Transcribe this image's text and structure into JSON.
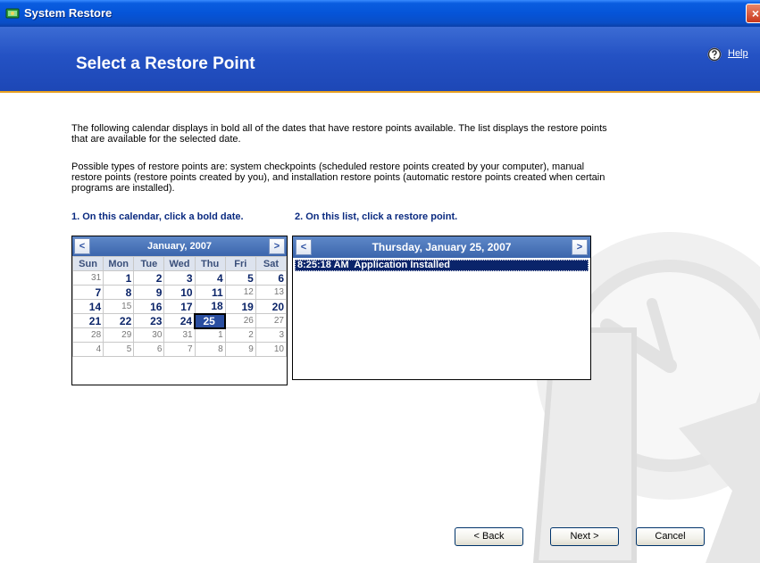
{
  "window": {
    "title": "System Restore",
    "close_label": "×"
  },
  "header": {
    "page_title": "Select a Restore Point",
    "help_label": "Help"
  },
  "intro": {
    "paragraph1": "The following calendar displays in bold all of the dates that have restore points available. The list displays the restore points that are available for the selected date.",
    "paragraph2": "Possible types of restore points are: system checkpoints (scheduled restore points created by your computer), manual restore points (restore points created by you), and installation restore points (automatic restore points created when certain programs are installed)."
  },
  "steps": {
    "step1": "1. On this calendar, click a bold date.",
    "step2": "2. On this list, click a restore point."
  },
  "calendar": {
    "month_label": "January, 2007",
    "prev_label": "<",
    "next_label": ">",
    "weekdays": [
      "Sun",
      "Mon",
      "Tue",
      "Wed",
      "Thu",
      "Fri",
      "Sat"
    ],
    "weeks": [
      [
        {
          "d": "31",
          "b": false
        },
        {
          "d": "1",
          "b": true
        },
        {
          "d": "2",
          "b": true
        },
        {
          "d": "3",
          "b": true
        },
        {
          "d": "4",
          "b": true
        },
        {
          "d": "5",
          "b": true
        },
        {
          "d": "6",
          "b": true
        }
      ],
      [
        {
          "d": "7",
          "b": true
        },
        {
          "d": "8",
          "b": true
        },
        {
          "d": "9",
          "b": true
        },
        {
          "d": "10",
          "b": true
        },
        {
          "d": "11",
          "b": true
        },
        {
          "d": "12",
          "b": false
        },
        {
          "d": "13",
          "b": false
        }
      ],
      [
        {
          "d": "14",
          "b": true
        },
        {
          "d": "15",
          "b": false
        },
        {
          "d": "16",
          "b": true
        },
        {
          "d": "17",
          "b": true
        },
        {
          "d": "18",
          "b": true
        },
        {
          "d": "19",
          "b": true
        },
        {
          "d": "20",
          "b": true
        }
      ],
      [
        {
          "d": "21",
          "b": true
        },
        {
          "d": "22",
          "b": true
        },
        {
          "d": "23",
          "b": true
        },
        {
          "d": "24",
          "b": true
        },
        {
          "d": "25",
          "b": true,
          "sel": true
        },
        {
          "d": "26",
          "b": false
        },
        {
          "d": "27",
          "b": false
        }
      ],
      [
        {
          "d": "28",
          "b": false
        },
        {
          "d": "29",
          "b": false
        },
        {
          "d": "30",
          "b": false
        },
        {
          "d": "31",
          "b": false
        },
        {
          "d": "1",
          "b": false
        },
        {
          "d": "2",
          "b": false
        },
        {
          "d": "3",
          "b": false
        }
      ],
      [
        {
          "d": "4",
          "b": false
        },
        {
          "d": "5",
          "b": false
        },
        {
          "d": "6",
          "b": false
        },
        {
          "d": "7",
          "b": false
        },
        {
          "d": "8",
          "b": false
        },
        {
          "d": "9",
          "b": false
        },
        {
          "d": "10",
          "b": false
        }
      ]
    ]
  },
  "restore_list": {
    "date_label": "Thursday, January 25, 2007",
    "prev_label": "<",
    "next_label": ">",
    "items": [
      {
        "label": "8:25:18 AM  Application Installed",
        "selected": true
      }
    ]
  },
  "buttons": {
    "back": "< Back",
    "next": "Next >",
    "cancel": "Cancel"
  },
  "colors": {
    "accent": "#1d47b6",
    "header_border": "#e8a020",
    "selection": "#0a246a"
  }
}
